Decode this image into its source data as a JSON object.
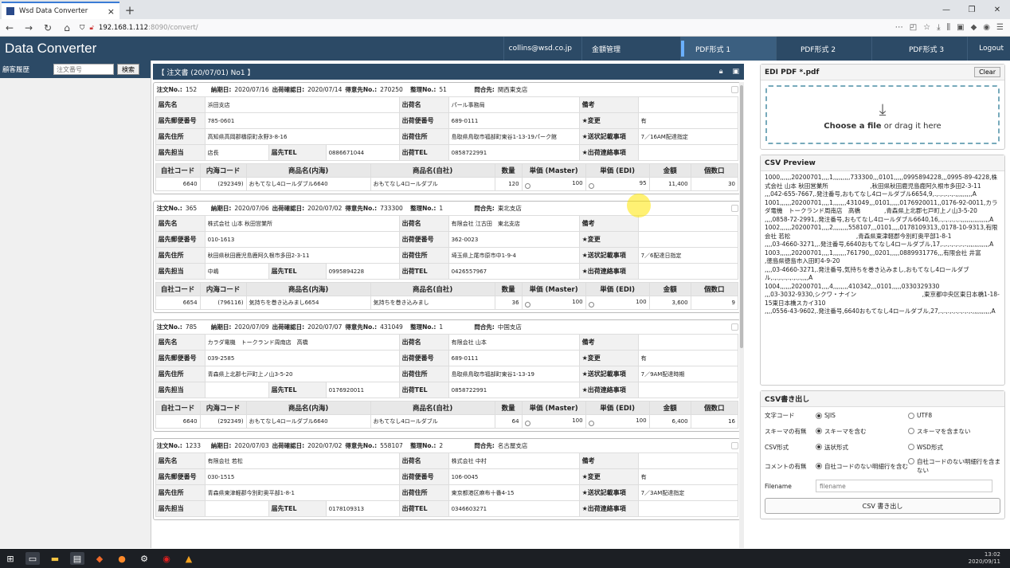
{
  "browser": {
    "tab_title": "Wsd Data Converter",
    "url_host": "192.168.1.112",
    "url_rest": ":8090/convert/"
  },
  "app": {
    "brand": "Data Converter",
    "nav": [
      "collins@wsd.co.jp",
      "金額管理",
      "PDF形式 1",
      "PDF形式 2",
      "PDF形式 3",
      "Logout"
    ]
  },
  "left": {
    "label": "顧客履歴",
    "placeholder": "注文番号",
    "button": "検索"
  },
  "center": {
    "header": "【 注文書 (20/07/01) No1 】"
  },
  "labels": {
    "order_no": "注文No.:",
    "delivery_date": "納期日:",
    "ship_date": "出荷確認日:",
    "cust_no": "得意先No.:",
    "ref_no": "整理No.:",
    "dest": "問合先:",
    "h1": "届先名",
    "h2": "届先郵便番号",
    "h3": "届先住所",
    "h4": "届先担当",
    "tel": "届先TEL",
    "s1": "出荷名",
    "s2": "出荷便番号",
    "s3": "出荷住所",
    "s4": "出荷TEL",
    "r1": "備考",
    "r2": "★変更",
    "r3": "★送状記載事項",
    "r4": "★出荷連絡事項",
    "cols": [
      "自社コード",
      "内海コード",
      "商品名(内海)",
      "商品名(自社)",
      "数量",
      "単価 (Master)",
      "単価 (EDI)",
      "金額",
      "個数口"
    ]
  },
  "orders": [
    {
      "no": "152",
      "delivery": "2020/07/16",
      "ship": "2020/07/14",
      "cust": "270250",
      "ref": "51",
      "dest": "関西東支店",
      "name": "浜田支店",
      "zip": "785-0601",
      "addr": "高知県高岡郡檮原町永野3-8-16",
      "person": "店長",
      "tel": "0886671044",
      "sname": "パール事務局",
      "szip": "689-0111",
      "saddr": "島取県鳥取市福部町東谷1-13-19パーク館",
      "stel": "0858722991",
      "note": "",
      "change": "有",
      "slip": "7／16AM配達指定",
      "contact": "",
      "item": {
        "code": "6640",
        "icode": "(292349)",
        "iname": "おもてなし4ロールダブル6640",
        "sname": "おもてなし4ロールダブル",
        "qty": "120",
        "master": "100",
        "edi": "95",
        "amount": "11,400",
        "boxes": "30"
      }
    },
    {
      "no": "365",
      "delivery": "2020/07/06",
      "ship": "2020/07/02",
      "cust": "733300",
      "ref": "1",
      "dest": "東北支店",
      "name": "株式会社 山本 秋田営業所",
      "zip": "010-1613",
      "addr": "秋田県秋田鹿児島鹿阿久根市多田2-3-11",
      "person": "中嶋",
      "tel": "0995894228",
      "sname": "有限会社 江古田　東北支店",
      "szip": "362-0023",
      "saddr": "埼玉県上尾市原市中1-9-4",
      "stel": "0426557967",
      "note": "",
      "change": "",
      "slip": "7／6配達日指定",
      "contact": "",
      "item": {
        "code": "6654",
        "icode": "(796116)",
        "iname": "気持ちを巻き込みまし6654",
        "sname": "気持ちを巻き込みまし",
        "qty": "36",
        "master": "100",
        "edi": "100",
        "amount": "3,600",
        "boxes": "9"
      }
    },
    {
      "no": "785",
      "delivery": "2020/07/09",
      "ship": "2020/07/07",
      "cust": "431049",
      "ref": "1",
      "dest": "中国支店",
      "name": "カラダ電機　トークランド周南店　高橋",
      "zip": "039-2585",
      "addr": "青森県上北郡七戸町上ノ山3-5-20",
      "person": "",
      "tel": "0176920011",
      "sname": "有限会社 山本",
      "szip": "689-0111",
      "saddr": "島取県鳥取市福部町東谷1-13-19",
      "stel": "0858722991",
      "note": "",
      "change": "有",
      "slip": "7／9AM配達時期",
      "contact": "",
      "item": {
        "code": "6640",
        "icode": "(292349)",
        "iname": "おもてなし4ロールダブル6640",
        "sname": "おもてなし4ロールダブル",
        "qty": "64",
        "master": "100",
        "edi": "100",
        "amount": "6,400",
        "boxes": "16"
      }
    },
    {
      "no": "1233",
      "delivery": "2020/07/03",
      "ship": "2020/07/02",
      "cust": "558107",
      "ref": "2",
      "dest": "名古屋支店",
      "name": "有限会社 若松",
      "zip": "030-1515",
      "addr": "青森県東津軽郡今別町奥平部1-8-1",
      "person": "",
      "tel": "0178109313",
      "sname": "株式会社 中村",
      "szip": "106-0045",
      "saddr": "東京都港区麻布十番4-15",
      "stel": "0346603271",
      "note": "",
      "change": "有",
      "slip": "7／3AM配達指定",
      "contact": ""
    }
  ],
  "right": {
    "edi_title": "EDI PDF *.pdf",
    "clear": "Clear",
    "choose_bold": "Choose a file",
    "choose_rest": " or drag it here",
    "csv_title": "CSV Preview",
    "csv_text": "1000,,,,,,20200701,,,,1,,,,,,,,,733300,,,0101,,,,,0995894228,,,0995-89-4228,株式会社 山本 秋田営業所　　　　　　　,秋田県秋田鹿児島鹿阿久根市多田2-3-11　　　　　　　　,,,042-655-7667,.発注番号,おもてなし4ロールダブル6654,9,.,.,.,.,.,.,,,,,,,,,A\n1001,,,,,,20200701,,,,1,,,,,,,431049,,,0101,,,,,0176920011,,0176-92-0011,カラダ電機　トークランド周南店　高橋　　　　,青森県上北郡七戸町上ノ山3-5-20\n,,,,0858-72-2991,.発注番号,おもてなし4ロールダブル6640,16,.,.,.,.,.,.,,,,,,,,,,,,,,,A\n1002,,,,,,20200701,,,,2,,,,,,,,558107,,,0101,,,,0178109313,,0178-10-9313,有限会社 若松　　　　　　　　　　　,青森県東津軽郡今別町奥平部1-8-1　　　　　　　　　　　,,,,03-4660-3271,,.発注番号,6640おもてなし4ロールダブル,17,.,.,.,.,.,.,.,,,,,,,,,,,,A\n1003,,,,,,20200701,,,,1,,,,,,,761790,,,0201,,,,,0889931776,,,有限会社 井富　　　　　　　　　　,徳島県徳島市入田町4-9-20\n,,,,03-4660-3271,.発注番号,気持ちを巻き込みまし,おもてなし4ロールダブル,.,.,.,.,.,.,.,.,,,,A\n1004,,,,,,20200701,,,,4,,,,,,,,410342,,,0101,,,,,0330329330\n,,,03-3032-9330,シクワ・ナイン　　　　　　　　　　　,東京都中央区東日本橋1-18-15東日本橋スカイ310\n,,,,0556-43-9602,.発注番号,6640おもてなし4ロールダブル,27,.,.,.,.,.,.,.,.,.,,,,,,,,,,A",
    "export_title": "CSV書き出し",
    "rows": [
      {
        "label": "文字コード",
        "opt1": "SJIS",
        "opt2": "UTF8"
      },
      {
        "label": "スキーマの有無",
        "opt1": "スキーマを含む",
        "opt2": "スキーマを含まない"
      },
      {
        "label": "CSV形式",
        "opt1": "送状形式",
        "opt2": "WSD形式"
      },
      {
        "label": "コメントの有無",
        "opt1": "自社コードのない明細行を含む",
        "opt2": "自社コードのない明細行を含まない"
      }
    ],
    "filename_label": "Filename",
    "filename_placeholder": "filename",
    "export_button": "CSV 書き出し"
  },
  "taskbar": {
    "time": "13:02",
    "date": "2020/09/11"
  }
}
